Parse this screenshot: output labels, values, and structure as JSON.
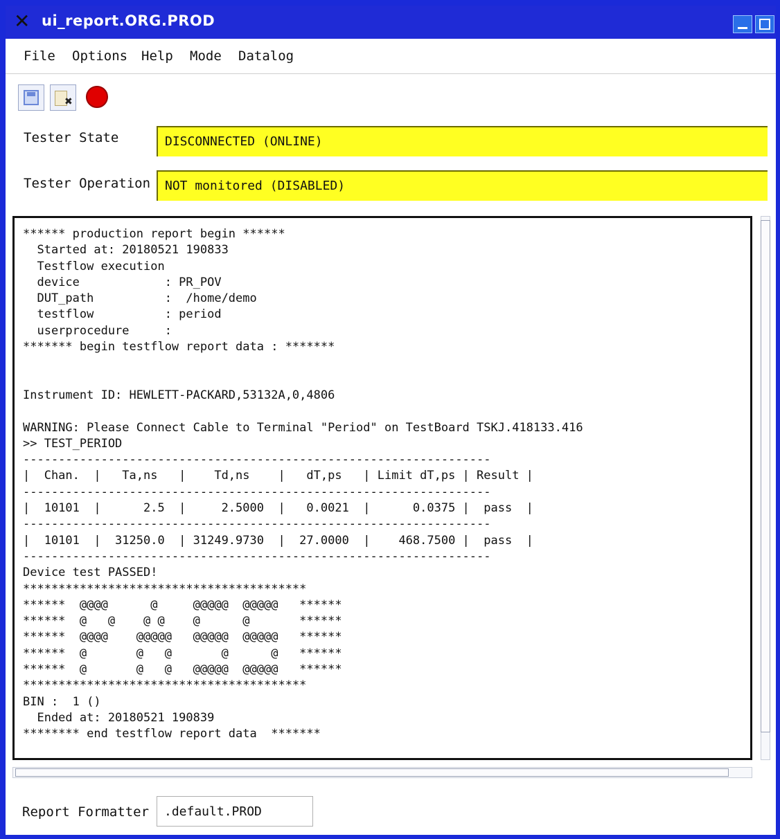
{
  "window": {
    "title": "ui_report.ORG.PROD"
  },
  "menu": {
    "items": [
      "File",
      "Options",
      "Help",
      "Mode",
      "Datalog"
    ]
  },
  "toolbar": {
    "icons": [
      "save-icon",
      "close-file-icon",
      "stop-icon"
    ]
  },
  "tester_state": {
    "label": "Tester State",
    "value": "DISCONNECTED (ONLINE)"
  },
  "tester_operation": {
    "label": "Tester Operation",
    "value": "NOT monitored (DISABLED)"
  },
  "report": {
    "text": "****** production report begin ******\n  Started at: 20180521 190833\n  Testflow execution\n  device            : PR_POV\n  DUT_path          :  /home/demo\n  testflow          : period\n  userprocedure     :\n******* begin testflow report data : *******\n\n\nInstrument ID: HEWLETT-PACKARD,53132A,0,4806\n\nWARNING: Please Connect Cable to Terminal \"Period\" on TestBoard TSKJ.418133.416\n>> TEST_PERIOD\n------------------------------------------------------------------\n|  Chan.  |   Ta,ns   |    Td,ns    |   dT,ps   | Limit dT,ps | Result |\n------------------------------------------------------------------\n|  10101  |      2.5  |     2.5000  |   0.0021  |      0.0375 |  pass  |\n------------------------------------------------------------------\n|  10101  |  31250.0  | 31249.9730  |  27.0000  |    468.7500 |  pass  |\n------------------------------------------------------------------\nDevice test PASSED!\n****************************************\n******  @@@@      @     @@@@@  @@@@@   ******\n******  @   @    @ @    @      @       ******\n******  @@@@    @@@@@   @@@@@  @@@@@   ******\n******  @       @   @       @      @   ******\n******  @       @   @   @@@@@  @@@@@   ******\n****************************************\nBIN :  1 ()\n  Ended at: 20180521 190839\n******** end testflow report data  *******"
  },
  "formatter": {
    "label": "Report Formatter",
    "value": ".default.PROD"
  }
}
